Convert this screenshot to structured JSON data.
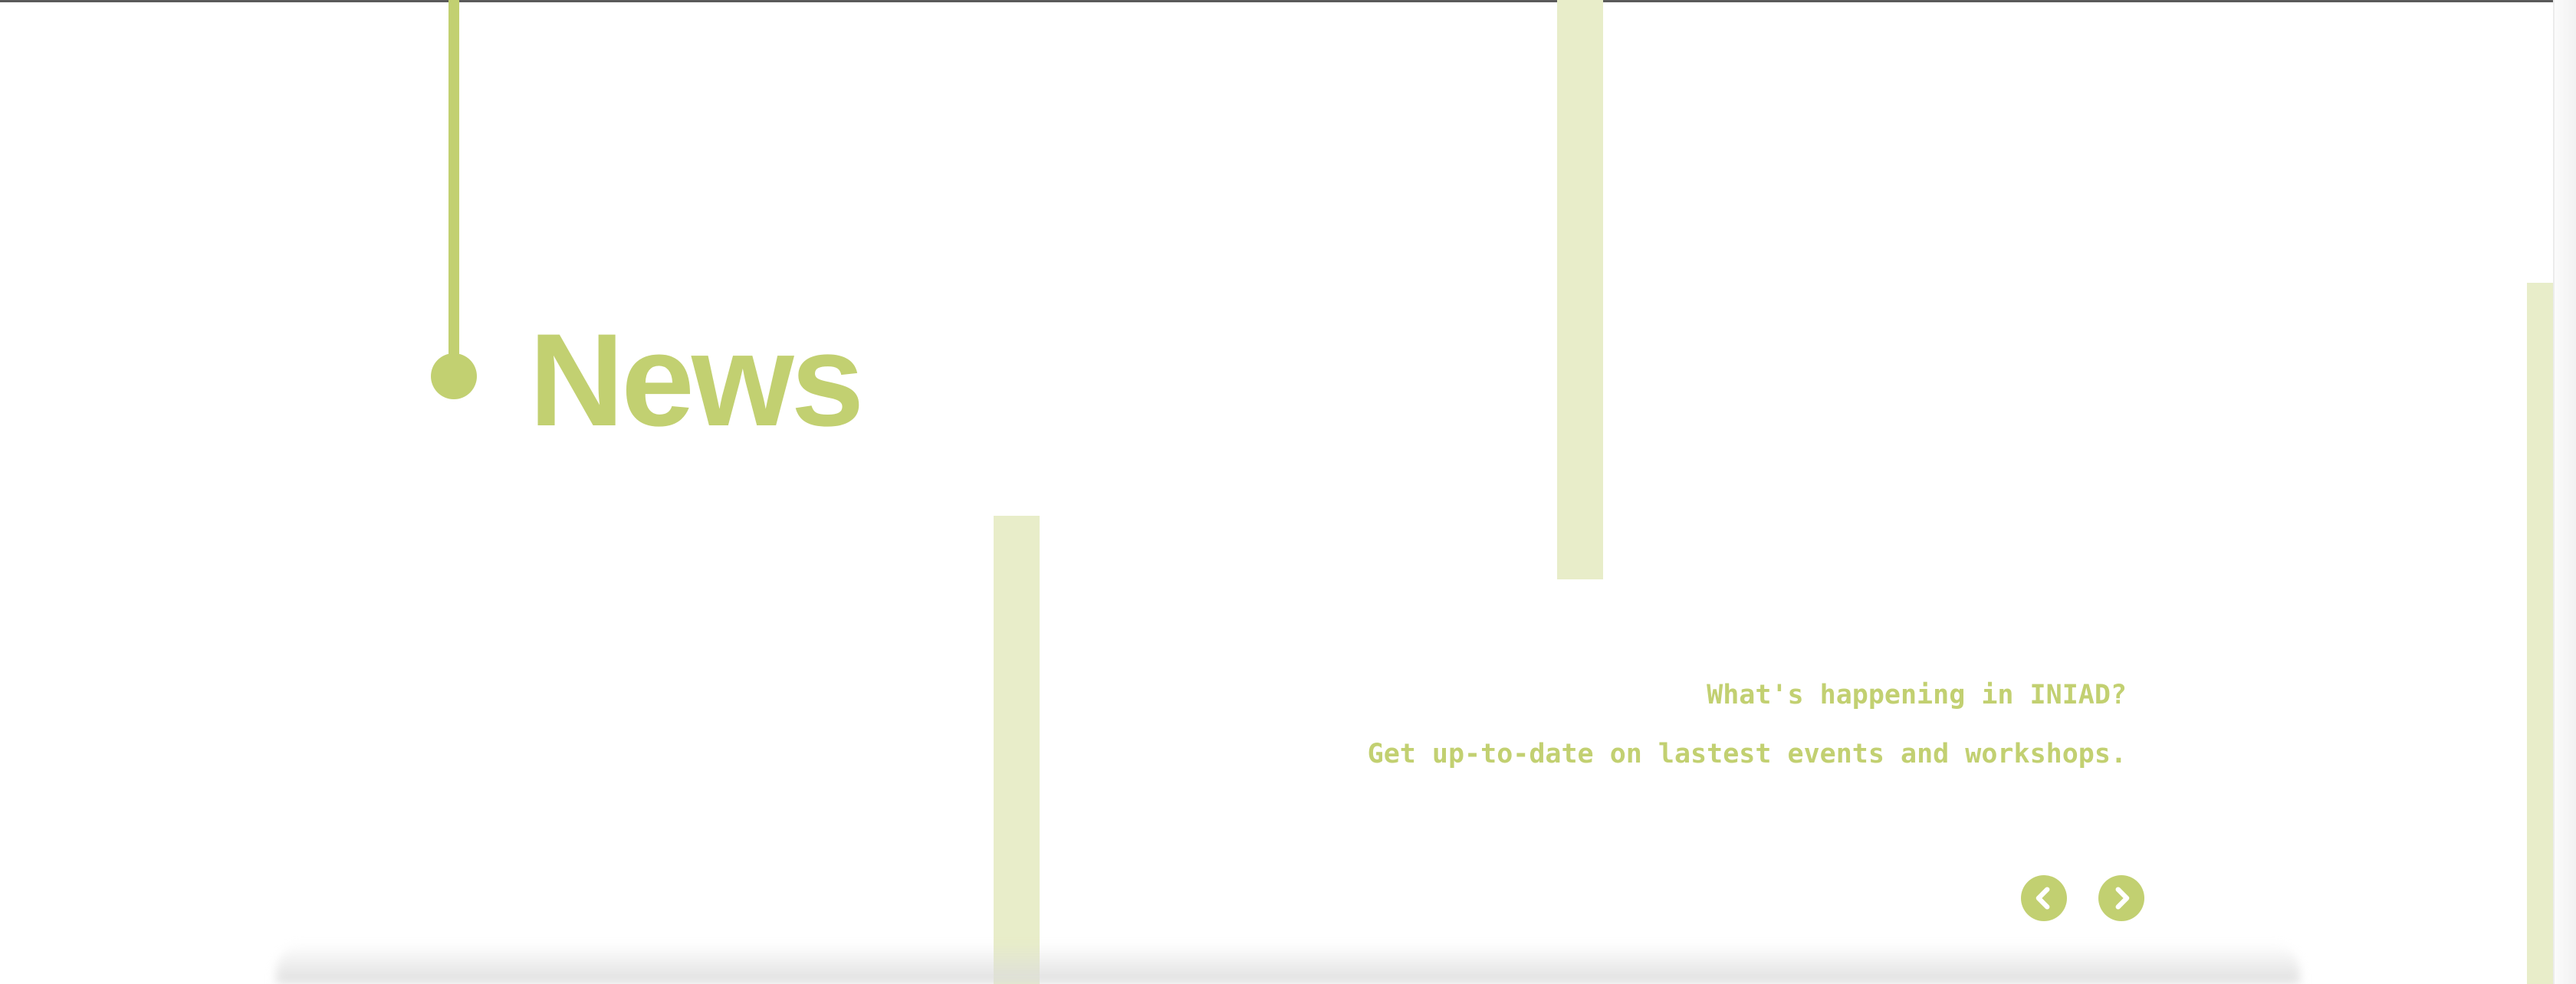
{
  "section": {
    "title": "News",
    "subtitle_line1": "What's happening in INIAD?",
    "subtitle_line2": "Get up-to-date on lastest events and workshops."
  },
  "navigation": {
    "prev_icon": "chevron-left-icon",
    "next_icon": "chevron-right-icon"
  },
  "colors": {
    "accent": "#c2d071",
    "accent_light": "#e8edc9",
    "background": "#ffffff"
  }
}
